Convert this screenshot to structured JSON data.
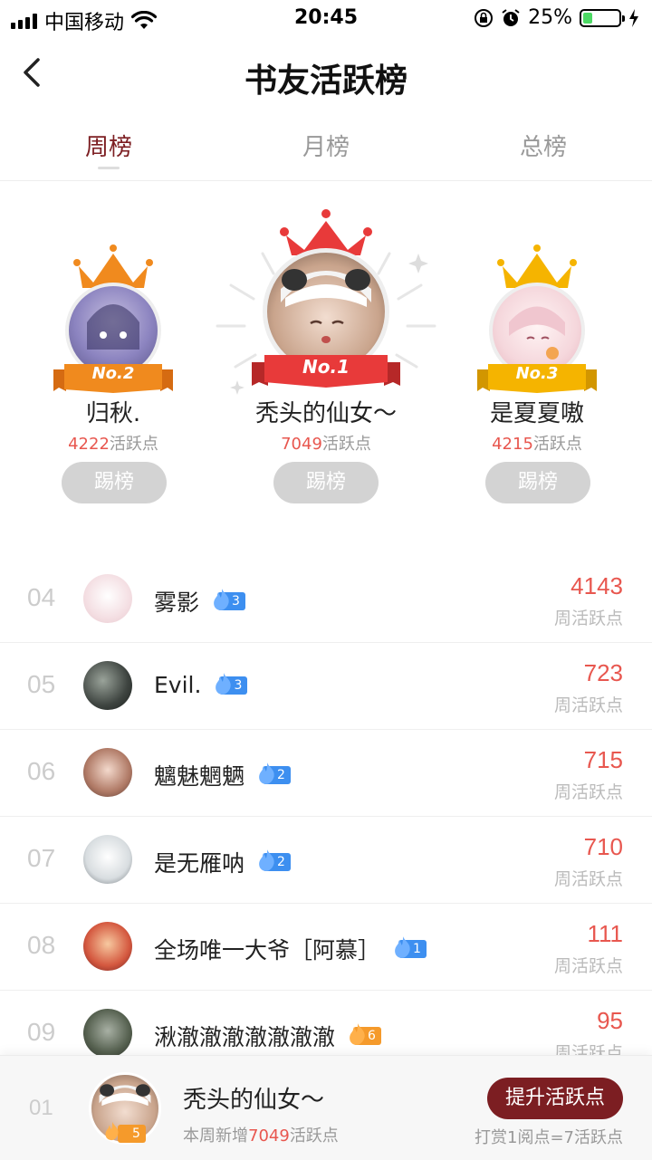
{
  "status_bar": {
    "carrier": "中国移动",
    "time": "20:45",
    "battery": "25%",
    "battery_level": 0.25
  },
  "header": {
    "title": "书友活跃榜"
  },
  "tabs": [
    {
      "label": "周榜",
      "active": true
    },
    {
      "label": "月榜",
      "active": false
    },
    {
      "label": "总榜",
      "active": false
    }
  ],
  "podium": {
    "first": {
      "rank_label": "No.1",
      "name": "秃头的仙女～",
      "points": "7049",
      "points_suffix": "活跃点",
      "button": "踢榜"
    },
    "second": {
      "rank_label": "No.2",
      "name": "归秋.",
      "points": "4222",
      "points_suffix": "活跃点",
      "button": "踢榜"
    },
    "third": {
      "rank_label": "No.3",
      "name": "是夏夏嗷",
      "points": "4215",
      "points_suffix": "活跃点",
      "button": "踢榜"
    }
  },
  "rank_list": [
    {
      "rank": "04",
      "name": "雾影",
      "level": "3",
      "badge_color": "blue",
      "score": "4143",
      "label": "周活跃点"
    },
    {
      "rank": "05",
      "name": "Evil.",
      "level": "3",
      "badge_color": "blue",
      "score": "723",
      "label": "周活跃点"
    },
    {
      "rank": "06",
      "name": "魑魅魍魉",
      "level": "2",
      "badge_color": "blue",
      "score": "715",
      "label": "周活跃点"
    },
    {
      "rank": "07",
      "name": "是无雁呐",
      "level": "2",
      "badge_color": "blue",
      "score": "710",
      "label": "周活跃点"
    },
    {
      "rank": "08",
      "name": "全场唯一大爷［阿慕］",
      "level": "1",
      "badge_color": "blue",
      "score": "111",
      "label": "周活跃点"
    },
    {
      "rank": "09",
      "name": "湫澈澈澈澈澈澈澈",
      "level": "6",
      "badge_color": "orange",
      "score": "95",
      "label": "周活跃点"
    }
  ],
  "me": {
    "rank": "01",
    "name": "秃头的仙女～",
    "level": "5",
    "sub_prefix": "本周新增",
    "sub_points": "7049",
    "sub_suffix": "活跃点",
    "button": "提升活跃点",
    "note": "打赏1阅点=7活跃点"
  },
  "colors": {
    "accent": "#7c1e22",
    "score_red": "#e8574f",
    "badge_blue": "#3d8ff0",
    "badge_orange": "#f59a2b",
    "crown_gold": "#f5b400",
    "crown_orange": "#f08a1e",
    "crown_red": "#e83a3a"
  }
}
